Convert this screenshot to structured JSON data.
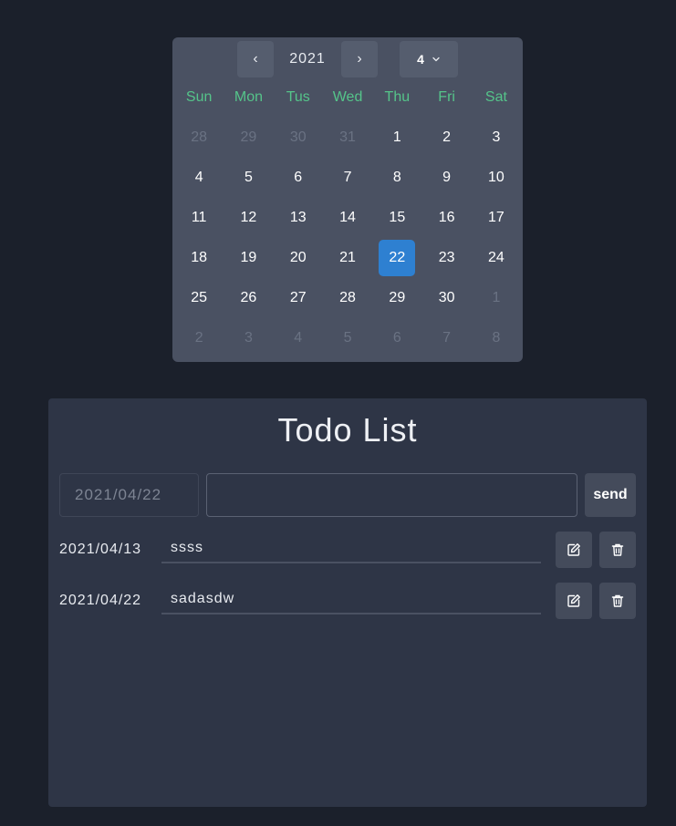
{
  "calendar": {
    "year": "2021",
    "month": "4",
    "prev_label": "‹",
    "next_label": "›",
    "weekdays": [
      "Sun",
      "Mon",
      "Tus",
      "Wed",
      "Thu",
      "Fri",
      "Sat"
    ],
    "days": [
      {
        "label": "28",
        "muted": true
      },
      {
        "label": "29",
        "muted": true
      },
      {
        "label": "30",
        "muted": true
      },
      {
        "label": "31",
        "muted": true
      },
      {
        "label": "1"
      },
      {
        "label": "2"
      },
      {
        "label": "3"
      },
      {
        "label": "4"
      },
      {
        "label": "5"
      },
      {
        "label": "6"
      },
      {
        "label": "7"
      },
      {
        "label": "8"
      },
      {
        "label": "9"
      },
      {
        "label": "10"
      },
      {
        "label": "11"
      },
      {
        "label": "12"
      },
      {
        "label": "13"
      },
      {
        "label": "14"
      },
      {
        "label": "15"
      },
      {
        "label": "16"
      },
      {
        "label": "17"
      },
      {
        "label": "18"
      },
      {
        "label": "19"
      },
      {
        "label": "20"
      },
      {
        "label": "21"
      },
      {
        "label": "22",
        "selected": true
      },
      {
        "label": "23"
      },
      {
        "label": "24"
      },
      {
        "label": "25"
      },
      {
        "label": "26"
      },
      {
        "label": "27"
      },
      {
        "label": "28"
      },
      {
        "label": "29"
      },
      {
        "label": "30"
      },
      {
        "label": "1",
        "muted": true
      },
      {
        "label": "2",
        "muted": true
      },
      {
        "label": "3",
        "muted": true
      },
      {
        "label": "4",
        "muted": true
      },
      {
        "label": "5",
        "muted": true
      },
      {
        "label": "6",
        "muted": true
      },
      {
        "label": "7",
        "muted": true
      },
      {
        "label": "8",
        "muted": true
      }
    ]
  },
  "todo": {
    "title": "Todo List",
    "date_value": "2021/04/22",
    "text_value": "",
    "send_label": "send",
    "items": [
      {
        "date": "2021/04/13",
        "text": "ssss"
      },
      {
        "date": "2021/04/22",
        "text": "sadasdw"
      }
    ]
  },
  "icons": {
    "month_dropdown": "chevron-down-icon",
    "edit": "edit-icon",
    "delete": "trash-icon"
  },
  "colors": {
    "weekday": "#55c48a",
    "selected_day": "#2e80d1",
    "background": "#1b202b"
  }
}
